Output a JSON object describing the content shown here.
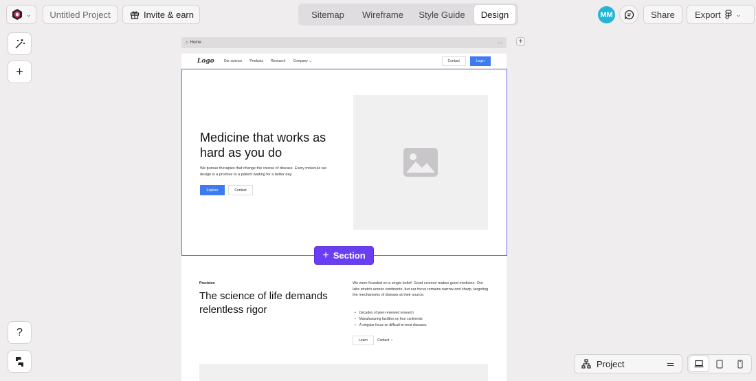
{
  "topbar": {
    "project_name": "Untitled Project",
    "invite_label": "Invite & earn",
    "tabs": [
      {
        "label": "Sitemap",
        "active": false
      },
      {
        "label": "Wireframe",
        "active": false
      },
      {
        "label": "Style Guide",
        "active": false
      },
      {
        "label": "Design",
        "active": true
      }
    ],
    "avatar_initials": "MM",
    "share_label": "Share",
    "export_label": "Export"
  },
  "canvas": {
    "page_tab": "Home",
    "nav": {
      "logo": "Logo",
      "links": [
        "Our science",
        "Products",
        "Research",
        "Company"
      ],
      "contact": "Contact",
      "login": "Login"
    },
    "hero": {
      "title": "Medicine that works as hard as you do",
      "body": "We pursue therapies that change the course of disease. Every molecule we design is a promise to a patient waiting for a better day.",
      "primary_button": "Explore",
      "secondary_button": "Contact"
    },
    "add_section_label": "Section",
    "section2": {
      "eyebrow": "Precision",
      "title": "The science of life demands relentless rigor",
      "body": "We were founded on a single belief. Good science makes good medicine. Our labs stretch across continents, but our focus remains narrow and sharp, targeting the mechanisms of disease at their source.",
      "list": [
        "Decades of peer-reviewed research",
        "Manufacturing facilities on four continents",
        "A singular focus on difficult-to-treat diseases"
      ],
      "learn_button": "Learn",
      "contact_link": "Contact"
    }
  },
  "bottom_panel": {
    "project_label": "Project"
  },
  "colors": {
    "accent": "#6a3ef2",
    "primary_button": "#3e7bf0",
    "avatar": "#23b5d3",
    "background": "#efedee"
  }
}
